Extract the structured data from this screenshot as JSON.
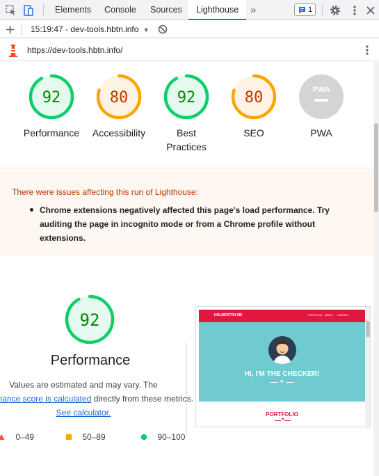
{
  "devtools": {
    "tabs": [
      {
        "label": "Elements"
      },
      {
        "label": "Console"
      },
      {
        "label": "Sources"
      },
      {
        "label": "Lighthouse"
      }
    ],
    "issues_count": "1",
    "more_tabs_glyph": "»"
  },
  "lighthouse_toolbar": {
    "report_selector": "15:19:47 - dev-tools.hbtn.info",
    "url": "https://dev-tools.hbtn.info/"
  },
  "scores": [
    {
      "value": "92",
      "label": "Performance",
      "status": "pass",
      "fraction": 0.92
    },
    {
      "value": "80",
      "label": "Accessibility",
      "status": "average",
      "fraction": 0.8
    },
    {
      "value": "92",
      "label": "Best Practices",
      "status": "pass",
      "fraction": 0.92
    },
    {
      "value": "80",
      "label": "SEO",
      "status": "average",
      "fraction": 0.8
    },
    {
      "value": "",
      "label": "PWA",
      "status": "na",
      "fraction": 0,
      "pwa_badge": "PWA"
    }
  ],
  "warning": {
    "title": "There were issues affecting this run of Lighthouse:",
    "items": [
      "Chrome extensions negatively affected this page's load performance. Try auditing the page in incognito mode or from a Chrome profile without extensions."
    ]
  },
  "performance": {
    "score": "92",
    "fraction": 0.92,
    "title": "Performance",
    "desc_part1": "Values are estimated and may vary. The",
    "desc_link1": "performance score is calculated",
    "desc_part2": "directly from these metrics.",
    "desc_link2": "See calculator."
  },
  "legend": {
    "fail": "0–49",
    "average": "50–89",
    "pass": "90–100"
  },
  "screenshot": {
    "brand": "HOLBERTON ME",
    "nav": [
      "PORTFOLIO",
      "ABOUT",
      "CONTACT"
    ],
    "hero_text": "HI, I'M THE CHECKER!",
    "section_title": "PORTFOLIO"
  },
  "colors": {
    "pass": "#0cce6b",
    "pass_text": "#008800",
    "pass_bg": "#e6f9ee",
    "average": "#ffa400",
    "average_text": "#c33300",
    "average_bg": "#fff3e3",
    "na": "#d4d4d4",
    "warn_bg": "#fff7f1",
    "hero_bg": "#6fcbd0",
    "brand_red": "#e2173f"
  }
}
